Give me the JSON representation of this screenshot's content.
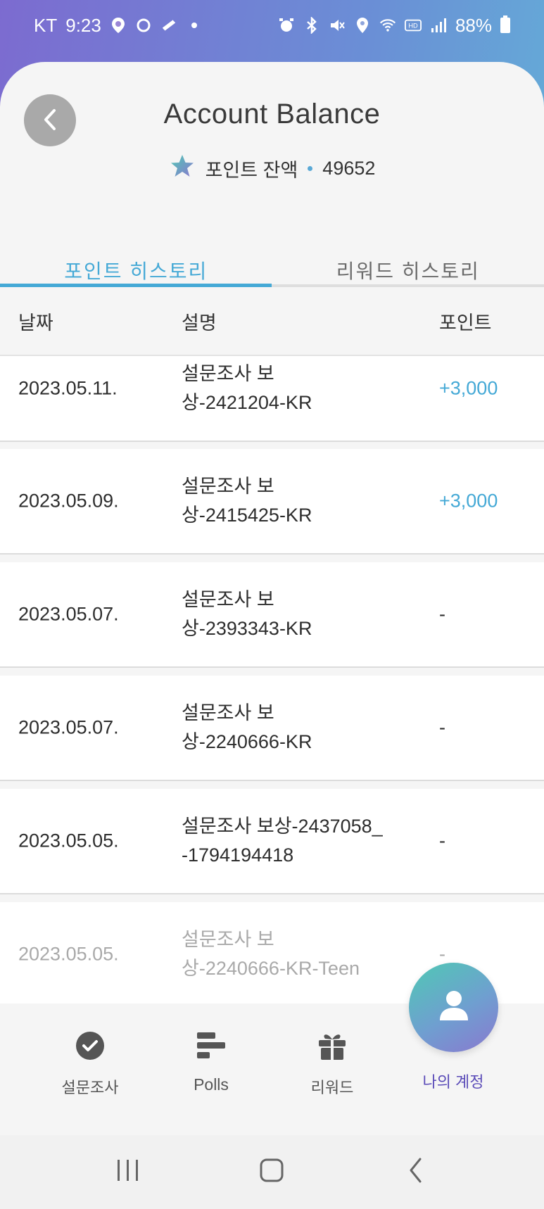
{
  "status_bar": {
    "carrier": "KT",
    "time": "9:23",
    "battery": "88%"
  },
  "header": {
    "title": "Account Balance",
    "balance_label": "포인트 잔액",
    "balance_value": "49652"
  },
  "tabs": [
    {
      "label": "포인트 히스토리",
      "active": true
    },
    {
      "label": "리워드 히스토리",
      "active": false
    }
  ],
  "table": {
    "headers": {
      "date": "날짜",
      "description": "설명",
      "points": "포인트"
    },
    "rows": [
      {
        "date": "2023.05.11.",
        "desc_line1": "설문조사 보",
        "desc_line2": "상-2421204-KR",
        "points": "+3,000"
      },
      {
        "date": "2023.05.09.",
        "desc_line1": "설문조사 보",
        "desc_line2": "상-2415425-KR",
        "points": "+3,000"
      },
      {
        "date": "2023.05.07.",
        "desc_line1": "설문조사 보",
        "desc_line2": "상-2393343-KR",
        "points": "-"
      },
      {
        "date": "2023.05.07.",
        "desc_line1": "설문조사 보",
        "desc_line2": "상-2240666-KR",
        "points": "-"
      },
      {
        "date": "2023.05.05.",
        "desc_line1": "설문조사 보상-2437058_",
        "desc_line2": "-1794194418",
        "points": "-"
      },
      {
        "date": "2023.05.05.",
        "desc_line1": "설문조사 보",
        "desc_line2": "상-2240666-KR-Teen",
        "points": "-"
      }
    ]
  },
  "bottom_nav": [
    {
      "label": "설문조사",
      "icon": "check-circle-icon"
    },
    {
      "label": "Polls",
      "icon": "bar-list-icon"
    },
    {
      "label": "리워드",
      "icon": "gift-icon"
    },
    {
      "label": "나의 계정",
      "icon": "user-icon",
      "active": true
    }
  ],
  "colors": {
    "accent": "#45a9d6",
    "active_nav": "#5a4bb8"
  }
}
